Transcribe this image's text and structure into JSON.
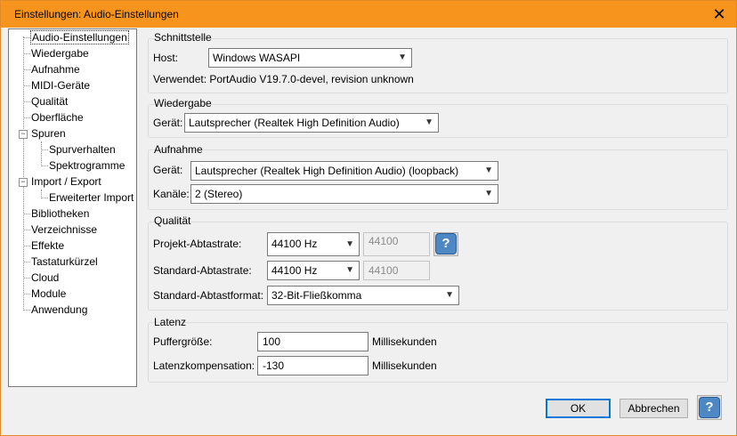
{
  "window": {
    "title": "Einstellungen: Audio-Einstellungen",
    "close_glyph": "✕"
  },
  "tree": {
    "items": [
      {
        "label": "Audio-Einstellungen"
      },
      {
        "label": "Wiedergabe"
      },
      {
        "label": "Aufnahme"
      },
      {
        "label": "MIDI-Geräte"
      },
      {
        "label": "Qualität"
      },
      {
        "label": "Oberfläche"
      },
      {
        "label": "Spuren"
      },
      {
        "label": "Spurverhalten"
      },
      {
        "label": "Spektrogramme"
      },
      {
        "label": "Import / Export"
      },
      {
        "label": "Erweiterter Import"
      },
      {
        "label": "Bibliotheken"
      },
      {
        "label": "Verzeichnisse"
      },
      {
        "label": "Effekte"
      },
      {
        "label": "Tastaturkürzel"
      },
      {
        "label": "Cloud"
      },
      {
        "label": "Module"
      },
      {
        "label": "Anwendung"
      }
    ],
    "expander_glyph": "−"
  },
  "interface": {
    "title": "Schnittstelle",
    "host_label": "Host:",
    "host_value": "Windows WASAPI",
    "used_label": "Verwendet: PortAudio V19.7.0-devel, revision unknown"
  },
  "playback": {
    "title": "Wiedergabe",
    "device_label": "Gerät:",
    "device_value": "Lautsprecher (Realtek High Definition Audio)"
  },
  "recording": {
    "title": "Aufnahme",
    "device_label": "Gerät:",
    "device_value": "Lautsprecher (Realtek High Definition Audio) (loopback)",
    "channels_label": "Kanäle:",
    "channels_value": "2 (Stereo)"
  },
  "quality": {
    "title": "Qualität",
    "project_rate_label": "Projekt-Abtastrate:",
    "project_rate_value": "44100 Hz",
    "project_rate_text": "44100",
    "default_rate_label": "Standard-Abtastrate:",
    "default_rate_value": "44100 Hz",
    "default_rate_text": "44100",
    "default_format_label": "Standard-Abtastformat:",
    "default_format_value": "32-Bit-Fließkomma",
    "help_glyph": "?"
  },
  "latency": {
    "title": "Latenz",
    "buffer_label": "Puffergröße:",
    "buffer_value": "100",
    "buffer_unit": "Millisekunden",
    "compensation_label": "Latenzkompensation:",
    "compensation_value": "-130",
    "compensation_unit": "Millisekunden"
  },
  "footer": {
    "ok_label": "OK",
    "cancel_label": "Abbrechen",
    "help_glyph": "?"
  },
  "dropdown_arrow": "▼"
}
